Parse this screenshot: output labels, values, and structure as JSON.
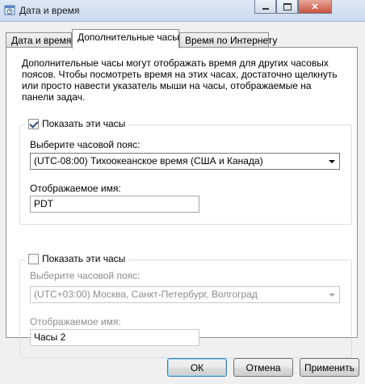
{
  "window": {
    "title": "Дата и время",
    "icon": "clock-calendar-icon"
  },
  "tabs": [
    {
      "label": "Дата и время"
    },
    {
      "label": "Дополнительные часы",
      "active": true
    },
    {
      "label": "Время по Интернету"
    }
  ],
  "description": "Дополнительные часы могут отображать время для других часовых поясов. Чтобы посмотреть время на этих часах, достаточно щелкнуть или просто навести указатель мыши на часы, отображаемые на панели задач.",
  "clock1": {
    "show_label": "Показать эти часы",
    "checked": true,
    "timezone_label": "Выберите часовой пояс:",
    "timezone_value": "(UTC-08:00) Тихоокеанское время (США и Канада)",
    "name_label": "Отображаемое имя:",
    "name_value": "PDT"
  },
  "clock2": {
    "show_label": "Показать эти часы",
    "checked": false,
    "timezone_label": "Выберите часовой пояс:",
    "timezone_value": "(UTC+03:00) Москва, Санкт-Петербург, Волгоград",
    "name_label": "Отображаемое имя:",
    "name_value": "Часы 2"
  },
  "buttons": {
    "ok": "ОК",
    "cancel": "Отмена",
    "apply": "Применить"
  }
}
